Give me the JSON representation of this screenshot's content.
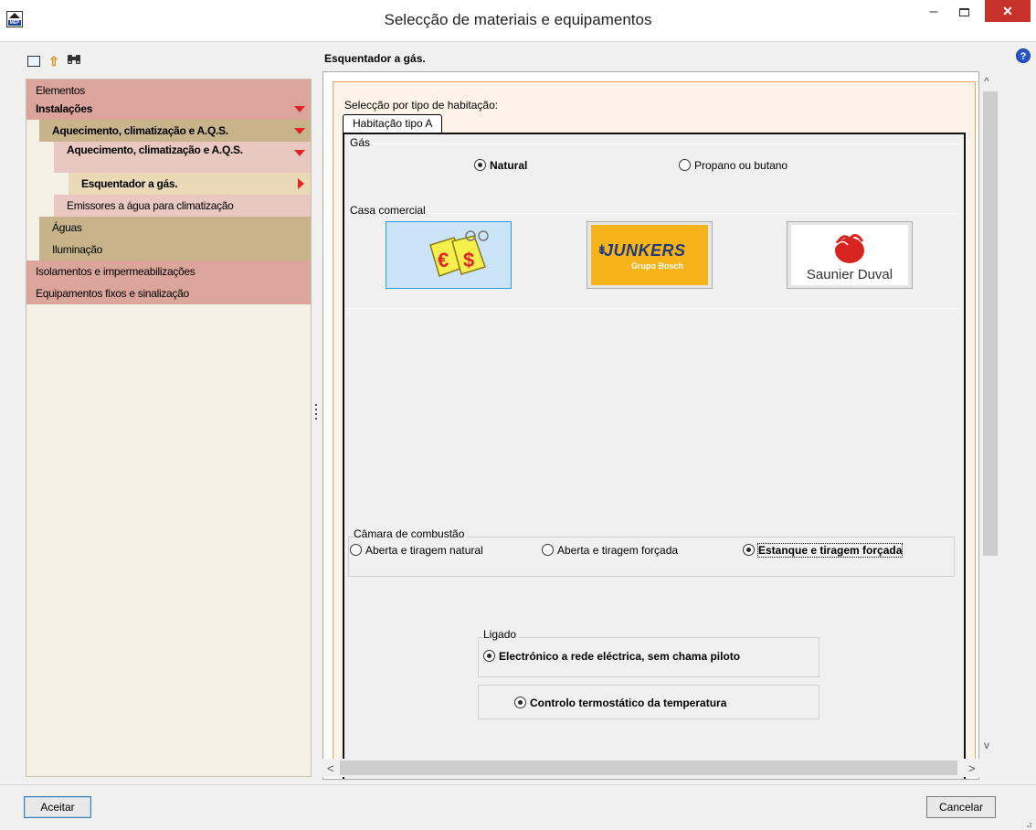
{
  "window": {
    "title": "Selecção de materiais e equipamentos",
    "app_icon_text": "MEP",
    "minimize_glyph": "–",
    "close_glyph": "✕",
    "help_glyph": "?"
  },
  "toolbar": {
    "icons": [
      "view-icon",
      "up-arrow-icon",
      "binoculars-icon"
    ],
    "glyphs": [
      "",
      "⇧",
      "🔭"
    ]
  },
  "tree": {
    "items": [
      {
        "label": "Elementos",
        "level": 0,
        "bold": false,
        "bg": "#dba59b",
        "indicator": "none"
      },
      {
        "label": "Instalações",
        "level": 0,
        "bold": true,
        "bg": "#dba59b",
        "indicator": "down"
      },
      {
        "label": "Aquecimento, climatização e A.Q.S.",
        "level": 1,
        "bold": true,
        "bg": "#c8b48a",
        "indicator": "down"
      },
      {
        "label": "Aquecimento, climatização e A.Q.S.",
        "level": 2,
        "bold": true,
        "bg": "#e8c8c0",
        "indicator": "down"
      },
      {
        "label": "Esquentador a gás.",
        "level": 3,
        "bold": true,
        "bg": "#ead9b6",
        "indicator": "right"
      },
      {
        "label": "Emissores a água para climatização",
        "level": 2,
        "bold": false,
        "bg": "#e8c8c0",
        "indicator": "none"
      },
      {
        "label": "Águas",
        "level": 1,
        "bold": false,
        "bg": "#c8b48a",
        "indicator": "none"
      },
      {
        "label": "Iluminação",
        "level": 1,
        "bold": false,
        "bg": "#c8b48a",
        "indicator": "none"
      },
      {
        "label": "Isolamentos e impermeabilizações",
        "level": 0,
        "bold": false,
        "bg": "#dba59b",
        "indicator": "none"
      },
      {
        "label": "Equipamentos fixos e sinalização",
        "level": 0,
        "bold": false,
        "bg": "#dba59b",
        "indicator": "none"
      }
    ]
  },
  "right": {
    "title": "Esquentador a gás.",
    "selection_label": "Selecção por tipo de habitação:",
    "tab_label": "Habitação tipo A",
    "gas": {
      "group_title": "Gás",
      "options": [
        {
          "label": "Natural",
          "selected": true
        },
        {
          "label": "Propano ou butano",
          "selected": false
        }
      ]
    },
    "brands": {
      "group_title": "Casa comercial",
      "items": [
        {
          "name": "generic-price-tags",
          "selected": true
        },
        {
          "name": "JUNKERS",
          "subtitle": "Grupo Bosch",
          "selected": false
        },
        {
          "name": "Saunier Duval",
          "selected": false
        }
      ]
    },
    "combustion": {
      "group_title": "Câmara de combustão",
      "options": [
        {
          "label": "Aberta e tiragem natural",
          "selected": false
        },
        {
          "label": "Aberta e tiragem forçada",
          "selected": false
        },
        {
          "label": "Estanque e tiragem forçada",
          "selected": true
        }
      ]
    },
    "ignition": {
      "group_title": "Ligado",
      "option": {
        "label": "Electrónico a rede eléctrica, sem chama piloto",
        "selected": true
      }
    },
    "thermostat": {
      "option": {
        "label": "Controlo termostático da temperatura",
        "selected": true
      }
    }
  },
  "buttons": {
    "ok": "Aceitar",
    "cancel": "Cancelar"
  },
  "scroll": {
    "up": "^",
    "down": "v",
    "left": "<",
    "right": ">"
  },
  "colors": {
    "accent_red": "#e0242a",
    "close_red": "#c7312a",
    "junkers_yellow": "#f6b31a",
    "panel_orange_border": "#f0a060"
  }
}
